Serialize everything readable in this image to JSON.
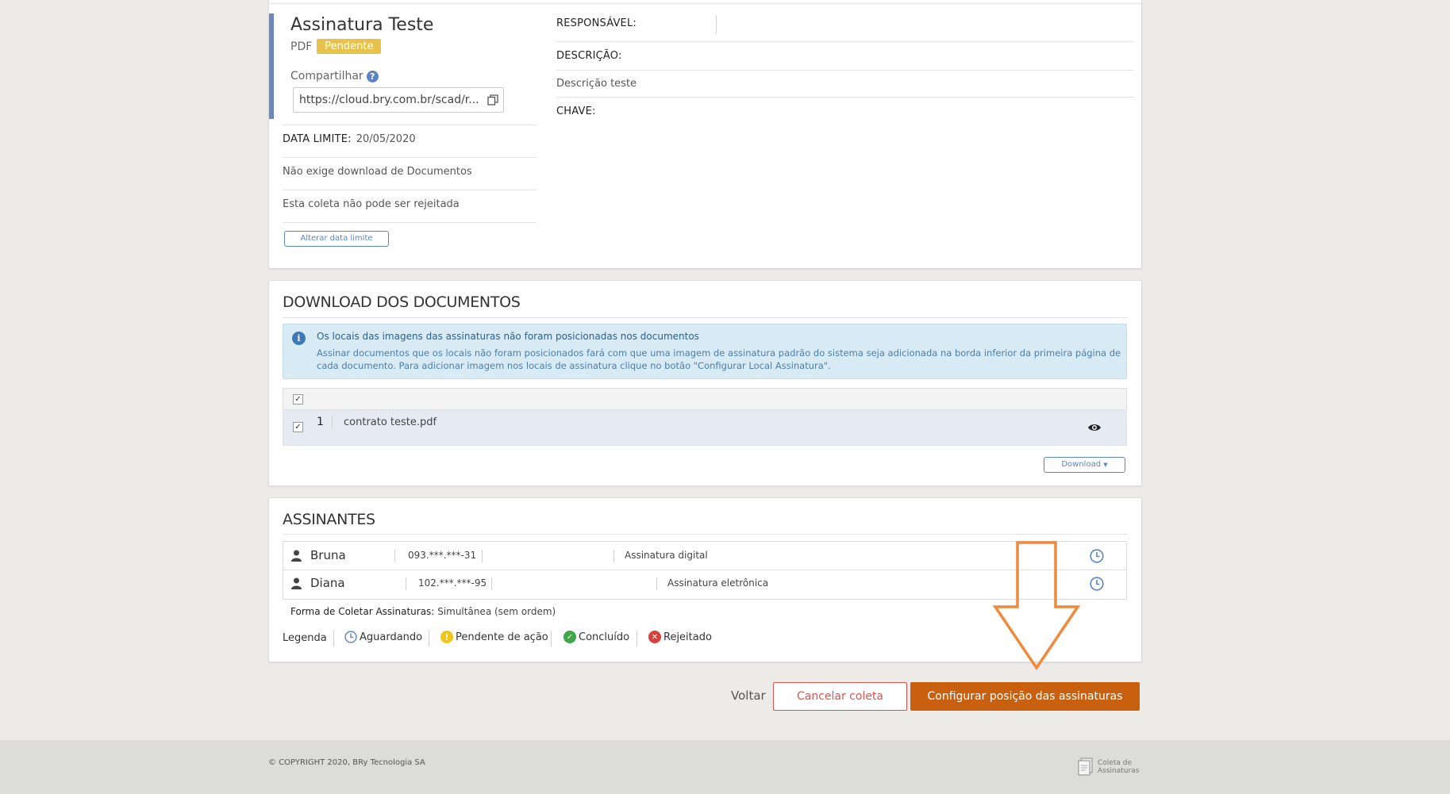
{
  "info": {
    "title": "Assinatura Teste",
    "type": "PDF",
    "status": "Pendente",
    "share_label": "Compartilhar",
    "share_url": "https://cloud.bry.com.br/scad/r...",
    "deadline_label": "DATA LIMITE:",
    "deadline_value": "20/05/2020",
    "download_note": "Não exige download de Documentos",
    "reject_note": "Esta coleta não pode ser rejeitada",
    "change_deadline_btn": "Alterar data limite",
    "responsible_label": "RESPONSÁVEL:",
    "description_label": "DESCRIÇÃO:",
    "description_value": "Descrição teste",
    "key_label": "CHAVE:"
  },
  "documents": {
    "title": "DOWNLOAD DOS DOCUMENTOS",
    "alert_title": "Os locais das imagens das assinaturas não foram posicionadas nos documentos",
    "alert_body_1": "Assinar documentos que os locais não foram posicionados fará com que uma imagem de assinatura padrão do sistema seja adicionada na borda inferior da primeira página de",
    "alert_body_2": "cada documento. Para adicionar imagem nos locais de assinatura clique no botão \"Configurar Local Assinatura\".",
    "rows": [
      {
        "index": "1",
        "name": "contrato teste.pdf"
      }
    ],
    "download_btn": "Download"
  },
  "signers": {
    "title": "ASSINANTES",
    "rows": [
      {
        "name": "Bruna",
        "doc": "093.***.***-31",
        "kind": "Assinatura digital"
      },
      {
        "name": "Diana",
        "doc": "102.***.***-95",
        "kind": "Assinatura eletrônica"
      }
    ],
    "mode_label": "Forma de Coletar Assinaturas:",
    "mode_value": "Simultânea (sem ordem)",
    "legend_label": "Legenda",
    "legend": {
      "waiting": "Aguardando",
      "pending": "Pendente de ação",
      "done": "Concluído",
      "rejected": "Rejeitado"
    }
  },
  "actions": {
    "back": "Voltar",
    "cancel": "Cancelar coleta",
    "configure": "Configurar posição das assinaturas"
  },
  "footer": {
    "copyright": "© COPYRIGHT 2020, BRy Tecnologia SA",
    "logo_line1": "Coleta de",
    "logo_line2": "Assinaturas"
  },
  "colors": {
    "accent_blue": "#5b84c4",
    "primary_orange": "#c8600f",
    "cancel_red": "#d9534f",
    "pending_yellow": "#e6c24a",
    "alert_bg": "#d8ebf5",
    "annotation_arrow": "#f0893a"
  }
}
